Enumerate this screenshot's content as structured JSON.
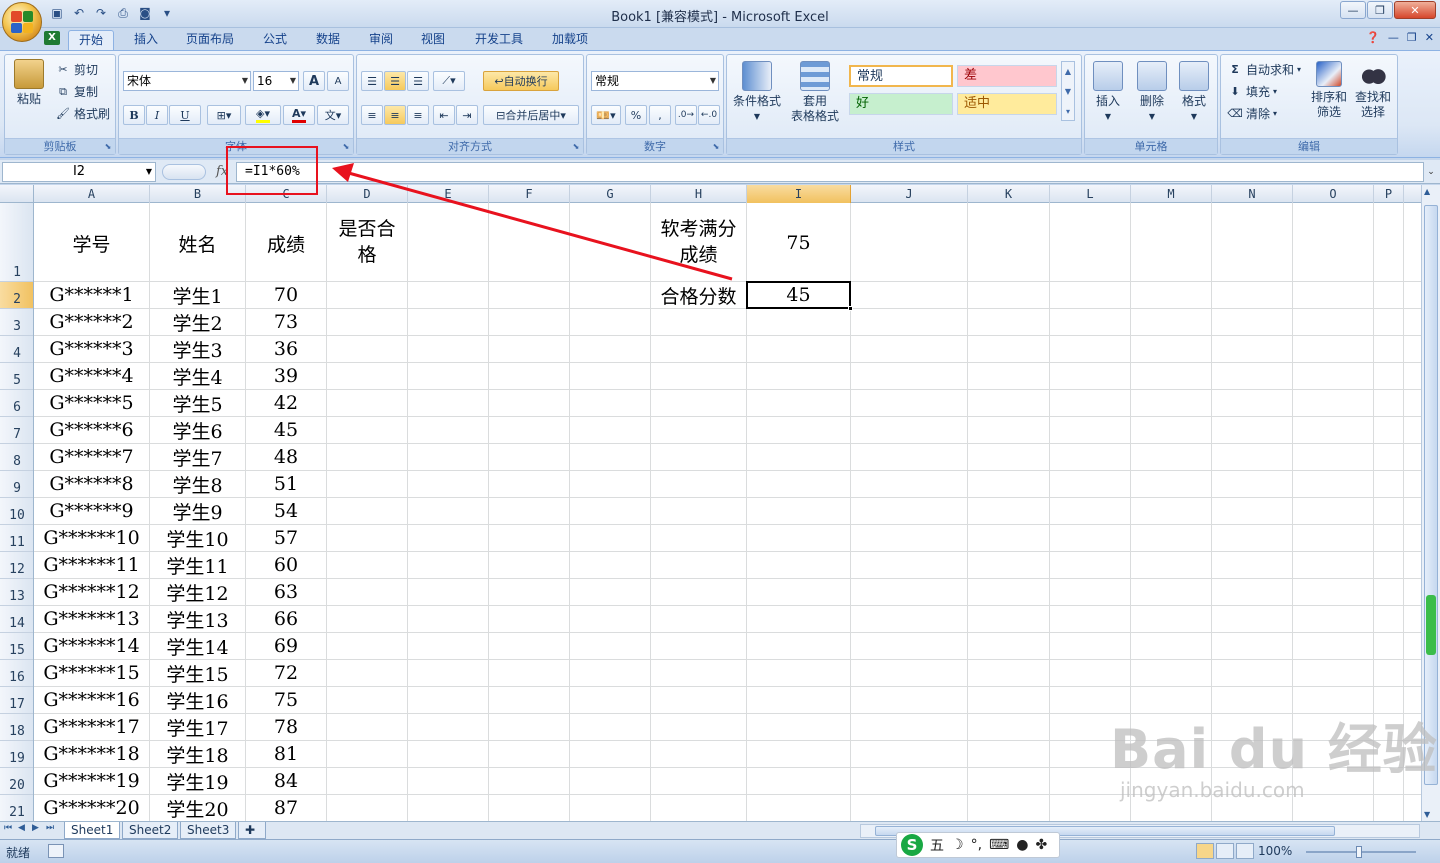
{
  "window": {
    "title": "Book1  [兼容模式] - Microsoft Excel",
    "minimize": "—",
    "restore": "❐",
    "close": "✕"
  },
  "tabs": [
    "开始",
    "插入",
    "页面布局",
    "公式",
    "数据",
    "审阅",
    "视图",
    "开发工具",
    "加载项"
  ],
  "ribbon": {
    "clipboard": {
      "label": "剪贴板",
      "paste": "粘贴",
      "cut": "剪切",
      "copy": "复制",
      "format_painter": "格式刷"
    },
    "font": {
      "label": "字体",
      "name": "宋体",
      "size": "16",
      "bold": "B",
      "italic": "I",
      "underline": "U",
      "grow": "A",
      "shrink": "A"
    },
    "alignment": {
      "label": "对齐方式",
      "wrap": "自动换行",
      "merge": "合并后居中"
    },
    "number": {
      "label": "数字",
      "format": "常规",
      "percent": "%",
      "comma": ","
    },
    "styles": {
      "label": "样式",
      "conditional": "条件格式",
      "table_line1": "套用",
      "table_line2": "表格格式",
      "normal": "常规",
      "bad": "差",
      "good": "好",
      "neutral": "适中"
    },
    "cells": {
      "label": "单元格",
      "insert": "插入",
      "delete": "删除",
      "format": "格式"
    },
    "editing": {
      "label": "编辑",
      "autosum": "自动求和",
      "fill": "填充",
      "clear": "清除",
      "sort_line1": "排序和",
      "sort_line2": "筛选",
      "find_line1": "查找和",
      "find_line2": "选择"
    }
  },
  "formula_bar": {
    "name_box": "I2",
    "fx": "fx",
    "formula": "=I1*60%"
  },
  "columns": [
    "A",
    "B",
    "C",
    "D",
    "E",
    "F",
    "G",
    "H",
    "I",
    "J",
    "K",
    "L",
    "M",
    "N",
    "O",
    "P"
  ],
  "selected_column": "I",
  "rows": [
    "1",
    "2",
    "3",
    "4",
    "5",
    "6",
    "7",
    "8",
    "9",
    "10",
    "11",
    "12",
    "13",
    "14",
    "15",
    "16",
    "17",
    "18",
    "19",
    "20",
    "21"
  ],
  "selected_row": "2",
  "headers": {
    "id": "学号",
    "name": "姓名",
    "score": "成绩",
    "pass": "是否合格",
    "full_label": "软考满分成绩",
    "full_value": "75",
    "pass_label": "合格分数",
    "pass_value": "45"
  },
  "students": [
    {
      "id": "G******1",
      "name": "学生1",
      "score": "70"
    },
    {
      "id": "G******2",
      "name": "学生2",
      "score": "73"
    },
    {
      "id": "G******3",
      "name": "学生3",
      "score": "36"
    },
    {
      "id": "G******4",
      "name": "学生4",
      "score": "39"
    },
    {
      "id": "G******5",
      "name": "学生5",
      "score": "42"
    },
    {
      "id": "G******6",
      "name": "学生6",
      "score": "45"
    },
    {
      "id": "G******7",
      "name": "学生7",
      "score": "48"
    },
    {
      "id": "G******8",
      "name": "学生8",
      "score": "51"
    },
    {
      "id": "G******9",
      "name": "学生9",
      "score": "54"
    },
    {
      "id": "G******10",
      "name": "学生10",
      "score": "57"
    },
    {
      "id": "G******11",
      "name": "学生11",
      "score": "60"
    },
    {
      "id": "G******12",
      "name": "学生12",
      "score": "63"
    },
    {
      "id": "G******13",
      "name": "学生13",
      "score": "66"
    },
    {
      "id": "G******14",
      "name": "学生14",
      "score": "69"
    },
    {
      "id": "G******15",
      "name": "学生15",
      "score": "72"
    },
    {
      "id": "G******16",
      "name": "学生16",
      "score": "75"
    },
    {
      "id": "G******17",
      "name": "学生17",
      "score": "78"
    },
    {
      "id": "G******18",
      "name": "学生18",
      "score": "81"
    },
    {
      "id": "G******19",
      "name": "学生19",
      "score": "84"
    },
    {
      "id": "G******20",
      "name": "学生20",
      "score": "87"
    }
  ],
  "sheets": [
    "Sheet1",
    "Sheet2",
    "Sheet3"
  ],
  "active_sheet": "Sheet1",
  "status": {
    "ready": "就绪",
    "zoom": "100%"
  },
  "ime": {
    "mode": "五"
  },
  "watermark": {
    "brand": "Bai du 经验",
    "url": "jingyan.baidu.com"
  },
  "colors": {
    "annotation": "#e8121e",
    "selection": "#f1c15f"
  }
}
